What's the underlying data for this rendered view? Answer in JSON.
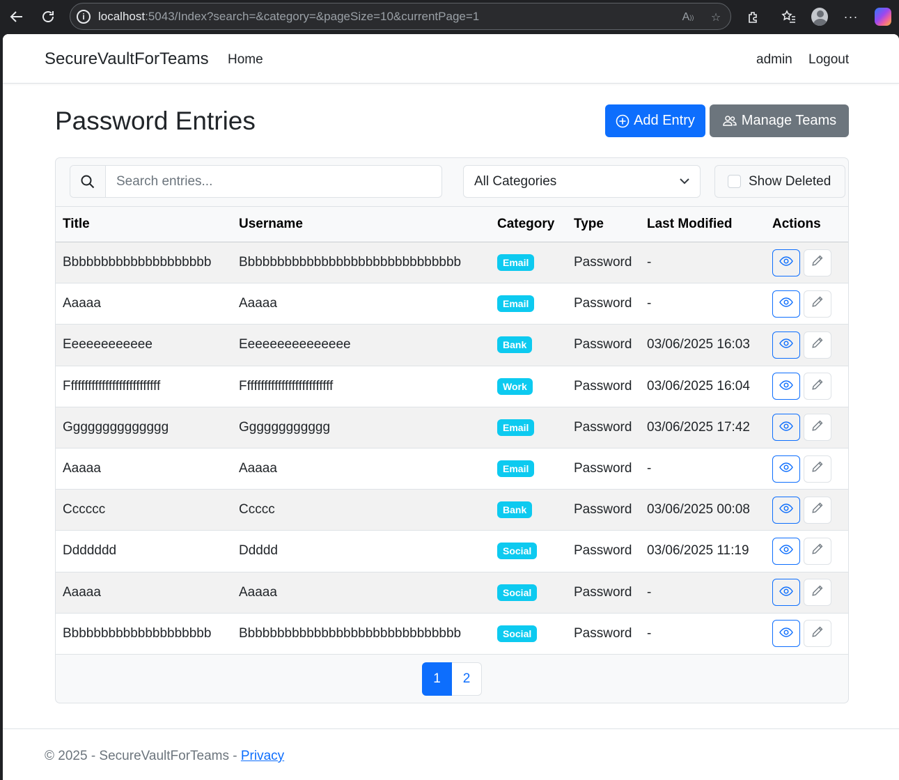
{
  "browser": {
    "url_host": "localhost",
    "url_rest": ":5043/Index?search=&category=&pageSize=10&currentPage=1"
  },
  "nav": {
    "brand": "SecureVaultForTeams",
    "home": "Home",
    "user": "admin",
    "logout": "Logout"
  },
  "header": {
    "title": "Password Entries",
    "add_entry": "Add Entry",
    "manage_teams": "Manage Teams"
  },
  "filters": {
    "search_placeholder": "Search entries...",
    "category_selected": "All Categories",
    "show_deleted": "Show Deleted"
  },
  "table": {
    "columns": [
      "Title",
      "Username",
      "Category",
      "Type",
      "Last Modified",
      "Actions"
    ],
    "rows": [
      {
        "title": "Bbbbbbbbbbbbbbbbbbbb",
        "username": "Bbbbbbbbbbbbbbbbbbbbbbbbbbbbbb",
        "category": "Email",
        "type": "Password",
        "modified": "-"
      },
      {
        "title": "Aaaaa",
        "username": "Aaaaa",
        "category": "Email",
        "type": "Password",
        "modified": "-"
      },
      {
        "title": "Eeeeeeeeeeee",
        "username": "Eeeeeeeeeeeeeee",
        "category": "Bank",
        "type": "Password",
        "modified": "03/06/2025 16:03"
      },
      {
        "title": "Fffffffffffffffffffffffffff",
        "username": "Ffffffffffffffffffffffffff",
        "category": "Work",
        "type": "Password",
        "modified": "03/06/2025 16:04"
      },
      {
        "title": "Gggggggggggggg",
        "username": "Gggggggggggg",
        "category": "Email",
        "type": "Password",
        "modified": "03/06/2025 17:42"
      },
      {
        "title": "Aaaaa",
        "username": "Aaaaa",
        "category": "Email",
        "type": "Password",
        "modified": "-"
      },
      {
        "title": "Cccccc",
        "username": "Ccccc",
        "category": "Bank",
        "type": "Password",
        "modified": "03/06/2025 00:08"
      },
      {
        "title": "Ddddddd",
        "username": "Ddddd",
        "category": "Social",
        "type": "Password",
        "modified": "03/06/2025 11:19"
      },
      {
        "title": "Aaaaa",
        "username": "Aaaaa",
        "category": "Social",
        "type": "Password",
        "modified": "-"
      },
      {
        "title": "Bbbbbbbbbbbbbbbbbbbb",
        "username": "Bbbbbbbbbbbbbbbbbbbbbbbbbbbbbb",
        "category": "Social",
        "type": "Password",
        "modified": "-"
      }
    ]
  },
  "pagination": {
    "pages": [
      "1",
      "2"
    ],
    "current": "1"
  },
  "footer": {
    "copyright": "© 2025 - SecureVaultForTeams - ",
    "privacy": "Privacy"
  },
  "colors": {
    "primary": "#0d6efd",
    "secondary": "#6c757d",
    "badge_info": "#0dcaf0"
  },
  "icons": {
    "view": "eye-icon",
    "edit": "pencil-icon",
    "search": "search-icon",
    "add": "plus-circle-icon",
    "teams": "people-icon"
  }
}
